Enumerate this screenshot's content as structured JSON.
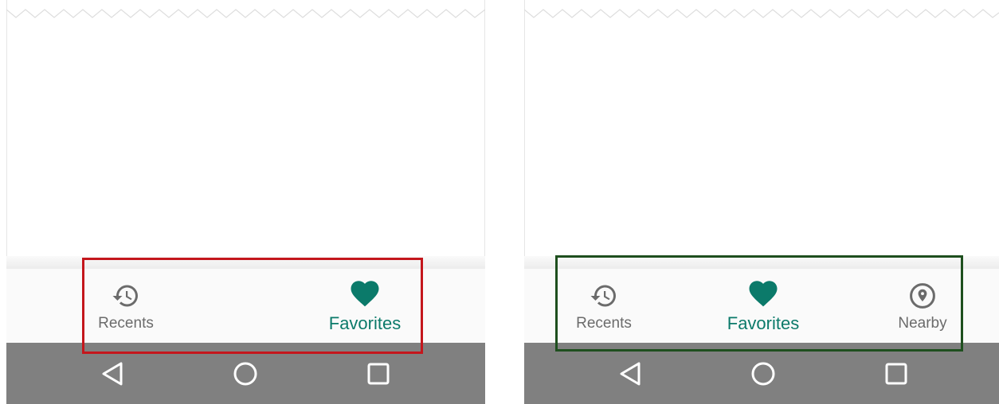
{
  "colors": {
    "accent": "#0b7a6a",
    "inactive": "#6b6b6b",
    "system_bar": "#808080",
    "left_highlight": "#c4161c",
    "right_highlight": "#1e4f1e"
  },
  "left_screen": {
    "nav_items": [
      {
        "label": "Recents",
        "icon": "history-icon",
        "active": false
      },
      {
        "label": "Favorites",
        "icon": "heart-icon",
        "active": true
      }
    ]
  },
  "right_screen": {
    "nav_items": [
      {
        "label": "Recents",
        "icon": "history-icon",
        "active": false
      },
      {
        "label": "Favorites",
        "icon": "heart-icon",
        "active": true
      },
      {
        "label": "Nearby",
        "icon": "location-icon",
        "active": false
      }
    ]
  },
  "system_nav": [
    "back-icon",
    "home-icon",
    "recents-square-icon"
  ]
}
